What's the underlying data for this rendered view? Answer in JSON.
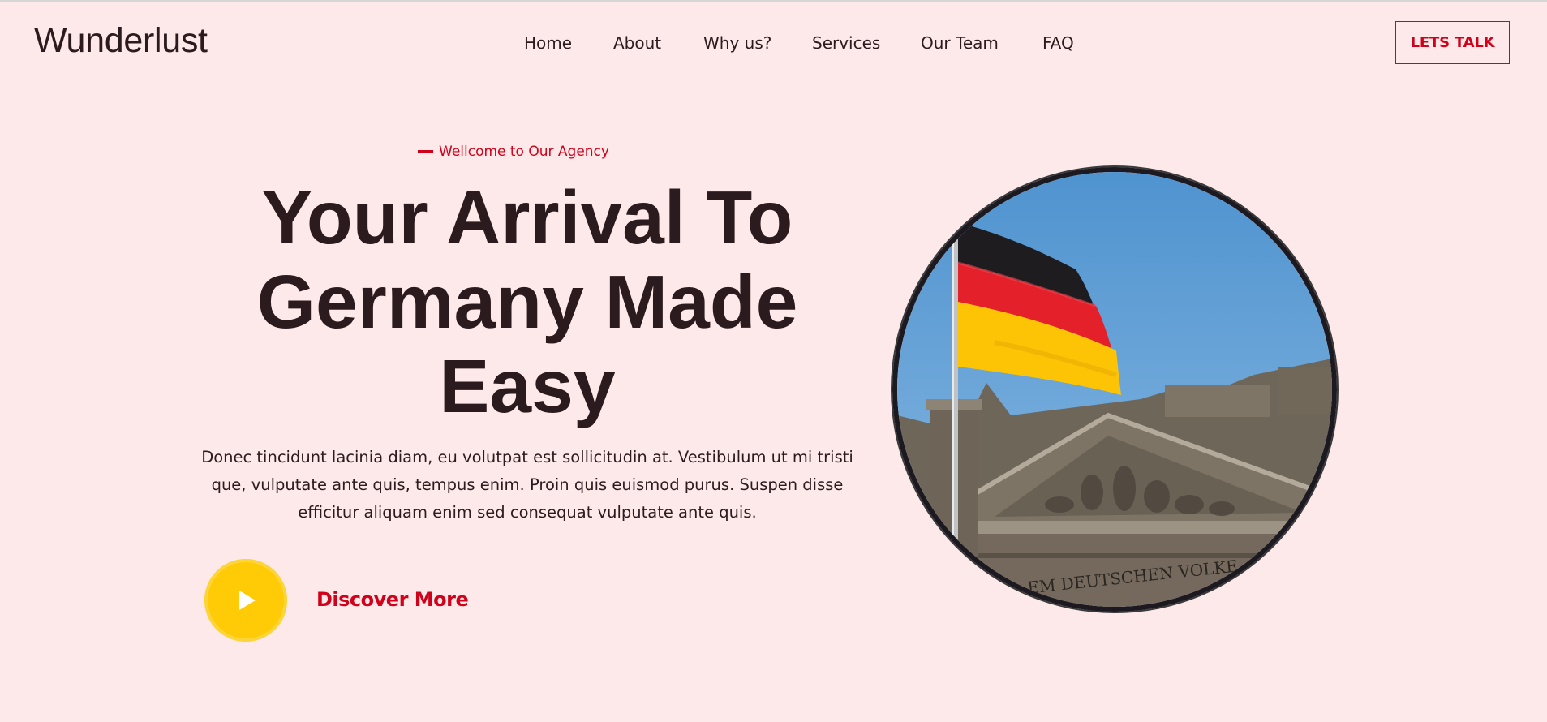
{
  "header": {
    "brand": "Wunderlust",
    "nav": [
      "Home",
      "About",
      "Why us?",
      "Services",
      "Our Team",
      "FAQ"
    ],
    "cta_label": "LETS TALK"
  },
  "hero": {
    "eyebrow": "Wellcome to Our Agency",
    "title_lines": [
      "Your Arrival To",
      "Germany Made",
      "Easy"
    ],
    "lead": "Donec tincidunt lacinia diam, eu volutpat est sollicitudin at. Vestibulum ut mi tristi que, vulputate ante quis, tempus enim. Proin quis euismod purus. Suspen disse efficitur aliquam enim sed consequat vulputate ante quis.",
    "discover_label": "Discover More",
    "image_inscription": "EM DEUTSCHEN VOLKE"
  },
  "colors": {
    "background": "#fde9e9",
    "accent": "#d0021b",
    "text": "#2b1b1e",
    "play_button": "#fecb06"
  },
  "icons": {
    "play": "play-icon"
  }
}
